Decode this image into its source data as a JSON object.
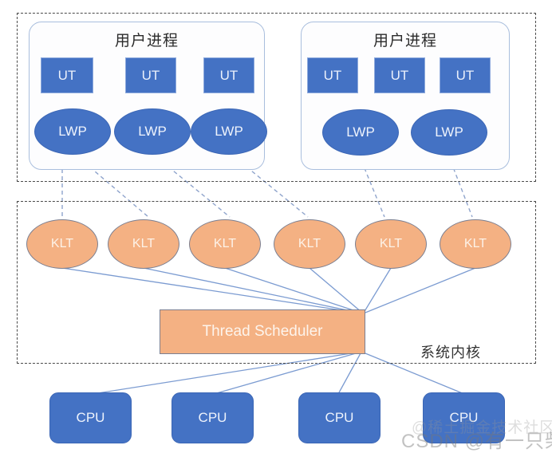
{
  "diagram": {
    "title_user_process": "用户进程",
    "kernel_label": "系统内核",
    "scheduler_label": "Thread Scheduler",
    "ut_label": "UT",
    "lwp_label": "LWP",
    "klt_label": "KLT",
    "cpu_label": "CPU",
    "colors": {
      "blue": "#4472C4",
      "orange": "#F4B183",
      "dash_border": "#4A4A4A",
      "proc_border": "#A9BEDD",
      "connector_solid": "#7B9BD1",
      "connector_dashed": "#8FA4CC"
    }
  },
  "user_region": {
    "groups": [
      {
        "title": "用户进程",
        "ut": [
          "UT",
          "UT",
          "UT"
        ],
        "lwp": [
          "LWP",
          "LWP",
          "LWP"
        ]
      },
      {
        "title": "用户进程",
        "ut": [
          "UT",
          "UT",
          "UT"
        ],
        "lwp": [
          "LWP",
          "LWP"
        ]
      }
    ]
  },
  "kernel_region": {
    "label": "系统内核",
    "klt": [
      "KLT",
      "KLT",
      "KLT",
      "KLT",
      "KLT",
      "KLT"
    ],
    "scheduler": "Thread Scheduler"
  },
  "hardware_region": {
    "cpus": [
      "CPU",
      "CPU",
      "CPU",
      "CPU"
    ]
  },
  "watermark": {
    "back": "@稀土掘金技术社区",
    "front": "CSDN @有一只柴犬"
  }
}
